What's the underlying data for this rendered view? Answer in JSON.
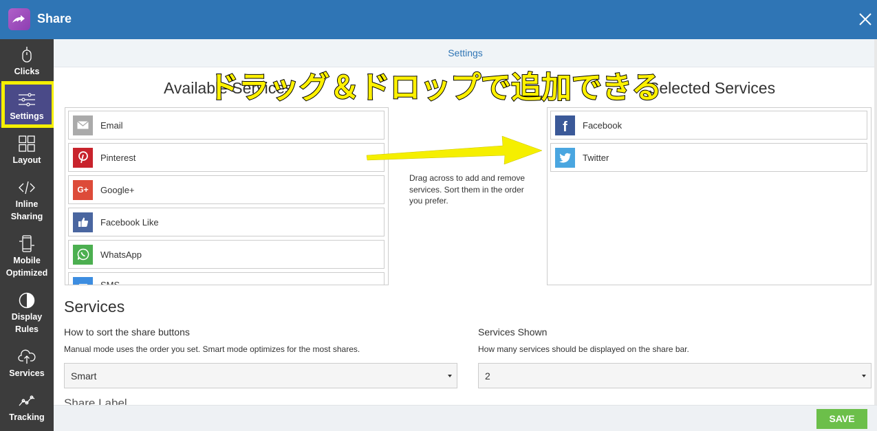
{
  "app": {
    "title": "Share"
  },
  "sidebar": {
    "items": [
      {
        "label": "Clicks",
        "icon": "mouse-icon"
      },
      {
        "label": "Settings",
        "icon": "sliders-icon"
      },
      {
        "label": "Layout",
        "icon": "grid-icon"
      },
      {
        "label1": "Inline",
        "label2": "Sharing",
        "icon": "code-icon"
      },
      {
        "label1": "Mobile",
        "label2": "Optimized",
        "icon": "phone-icon"
      },
      {
        "label1": "Display",
        "label2": "Rules",
        "icon": "contrast-icon"
      },
      {
        "label": "Services",
        "icon": "cloud-upload-icon"
      },
      {
        "label": "Tracking",
        "icon": "line-chart-icon"
      }
    ],
    "active": "Settings"
  },
  "main": {
    "section_tab": "Settings",
    "available_title": "Available Services",
    "selected_title": "Selected Services",
    "banner": "ドラッグ＆ドロップで追加できる",
    "drag_hint": "Drag across to add and remove services. Sort them in the order you prefer.",
    "available_services": [
      {
        "label": "Email",
        "color": "#aaaaaa",
        "icon": "envelope-icon"
      },
      {
        "label": "Pinterest",
        "color": "#c8232c",
        "icon": "pinterest-icon"
      },
      {
        "label": "Google+",
        "color": "#dd4b39",
        "icon": "google-plus-icon"
      },
      {
        "label": "Facebook Like",
        "color": "#4a66a0",
        "icon": "thumbs-up-icon"
      },
      {
        "label": "WhatsApp",
        "color": "#4caf50",
        "icon": "whatsapp-icon"
      },
      {
        "label": "SMS",
        "color": "#3d8de0",
        "icon": "sms-icon"
      }
    ],
    "selected_services": [
      {
        "label": "Facebook",
        "color": "#3b5998",
        "icon": "facebook-icon"
      },
      {
        "label": "Twitter",
        "color": "#4aa6e0",
        "icon": "twitter-icon"
      }
    ],
    "services_heading": "Services",
    "sort": {
      "label": "How to sort the share buttons",
      "help": "Manual mode uses the order you set. Smart mode optimizes for the most shares.",
      "value": "Smart"
    },
    "shown": {
      "label": "Services Shown",
      "help": "How many services should be displayed on the share bar.",
      "value": "2"
    },
    "cut_text": "Share Label",
    "save_label": "SAVE"
  }
}
